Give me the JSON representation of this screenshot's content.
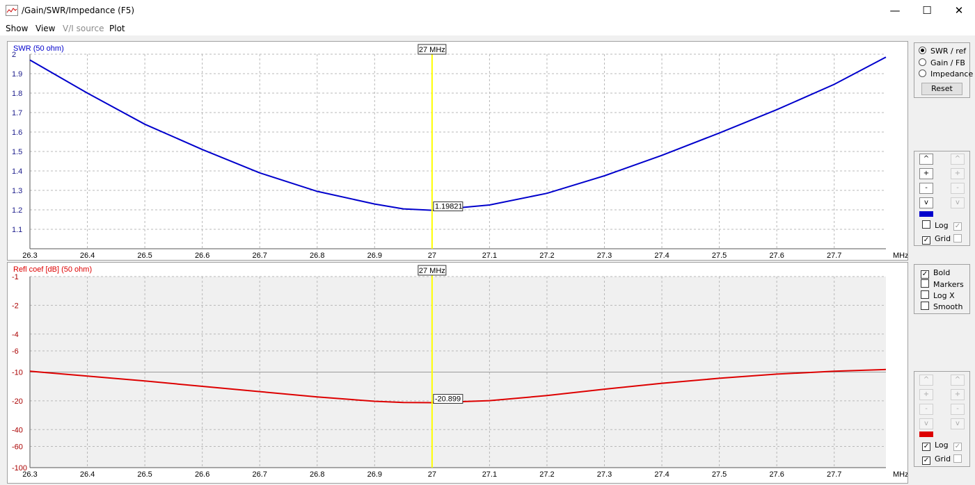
{
  "window": {
    "title": "/Gain/SWR/Impedance (F5)",
    "minimize": "—",
    "maximize": "☐",
    "close": "✕"
  },
  "menu": [
    {
      "label": "Show",
      "enabled": true
    },
    {
      "label": "View",
      "enabled": true
    },
    {
      "label": "V/I source",
      "enabled": false
    },
    {
      "label": "Plot",
      "enabled": true
    }
  ],
  "graphs": {
    "swr": {
      "ylabel": "SWR (50 ohm)",
      "marker_label": "27 MHz",
      "value_label": "1.19821",
      "xunit": "MHz",
      "color": "#0000cc"
    },
    "refl": {
      "ylabel": "Refl coef [dB] (50 ohm)",
      "marker_label": "27 MHz",
      "value_label": "-20.899",
      "xunit": "MHz",
      "color": "#dd0000"
    }
  },
  "chart_data": [
    {
      "type": "line",
      "title": "",
      "ylabel": "SWR (50 ohm)",
      "xlabel": "MHz",
      "xlim": [
        26.3,
        27.79
      ],
      "ylim": [
        1.0,
        2.0
      ],
      "x_ticks": [
        "26.3",
        "26.4",
        "26.5",
        "26.6",
        "26.7",
        "26.8",
        "26.9",
        "27",
        "27.1",
        "27.2",
        "27.3",
        "27.4",
        "27.5",
        "27.6",
        "27.7"
      ],
      "y_ticks": [
        "2",
        "1.9",
        "1.8",
        "1.7",
        "1.6",
        "1.5",
        "1.4",
        "1.3",
        "1.2",
        "1.1"
      ],
      "grid": true,
      "marker": {
        "x": 27.0,
        "y": 1.19821
      },
      "series": [
        {
          "color": "#0000cc",
          "x": [
            26.3,
            26.4,
            26.5,
            26.6,
            26.7,
            26.8,
            26.9,
            26.95,
            27.0,
            27.1,
            27.2,
            27.3,
            27.4,
            27.5,
            27.6,
            27.7,
            27.79
          ],
          "values": [
            1.97,
            1.8,
            1.64,
            1.51,
            1.39,
            1.295,
            1.23,
            1.205,
            1.198,
            1.225,
            1.285,
            1.375,
            1.48,
            1.595,
            1.715,
            1.845,
            1.985
          ]
        }
      ]
    },
    {
      "type": "line",
      "title": "",
      "ylabel": "Refl coef [dB] (50 ohm)",
      "xlabel": "MHz",
      "xlim": [
        26.3,
        27.79
      ],
      "ylim": [
        -100,
        -1
      ],
      "y_scale": "log",
      "x_ticks": [
        "26.3",
        "26.4",
        "26.5",
        "26.6",
        "26.7",
        "26.8",
        "26.9",
        "27",
        "27.1",
        "27.2",
        "27.3",
        "27.4",
        "27.5",
        "27.6",
        "27.7"
      ],
      "y_ticks": [
        "-1",
        "-2",
        "-4",
        "-6",
        "-10",
        "-20",
        "-40",
        "-60",
        "-100"
      ],
      "grid": true,
      "marker": {
        "x": 27.0,
        "y": -20.899
      },
      "series": [
        {
          "color": "#dd0000",
          "x": [
            26.3,
            26.4,
            26.5,
            26.6,
            26.7,
            26.8,
            26.9,
            26.95,
            27.0,
            27.1,
            27.2,
            27.3,
            27.4,
            27.5,
            27.6,
            27.7,
            27.79
          ],
          "values": [
            -9.8,
            -11.0,
            -12.4,
            -14.1,
            -16.0,
            -18.2,
            -20.2,
            -20.8,
            -20.9,
            -19.9,
            -17.6,
            -15.1,
            -13.1,
            -11.6,
            -10.5,
            -9.8,
            -9.4
          ]
        }
      ]
    }
  ],
  "panel_top": {
    "radios": [
      {
        "label": "SWR / ref",
        "checked": true
      },
      {
        "label": "Gain / FB",
        "checked": false
      },
      {
        "label": "Impedance",
        "checked": false
      }
    ],
    "reset_label": "Reset"
  },
  "panel_swr_scale": {
    "buttons_left": [
      "^",
      "+",
      "-",
      "v"
    ],
    "buttons_right": [
      "^",
      "+",
      "-",
      "v"
    ],
    "swatch_color": "#0000cc",
    "log_label": "Log",
    "grid_label": "Grid",
    "log_checked": false,
    "grid_checked": true,
    "log_right_checked": true,
    "grid_right_checked": false
  },
  "panel_options": {
    "items": [
      {
        "label": "Bold",
        "checked": true
      },
      {
        "label": "Markers",
        "checked": false
      },
      {
        "label": "Log X",
        "checked": false
      },
      {
        "label": "Smooth",
        "checked": false
      }
    ]
  },
  "panel_refl_scale": {
    "buttons_left": [
      "^",
      "+",
      "-",
      "v"
    ],
    "buttons_right": [
      "^",
      "+",
      "-",
      "v"
    ],
    "swatch_color": "#dd0000",
    "log_label": "Log",
    "grid_label": "Grid",
    "log_checked": true,
    "grid_checked": true,
    "log_right_checked": true,
    "grid_right_checked": false
  }
}
